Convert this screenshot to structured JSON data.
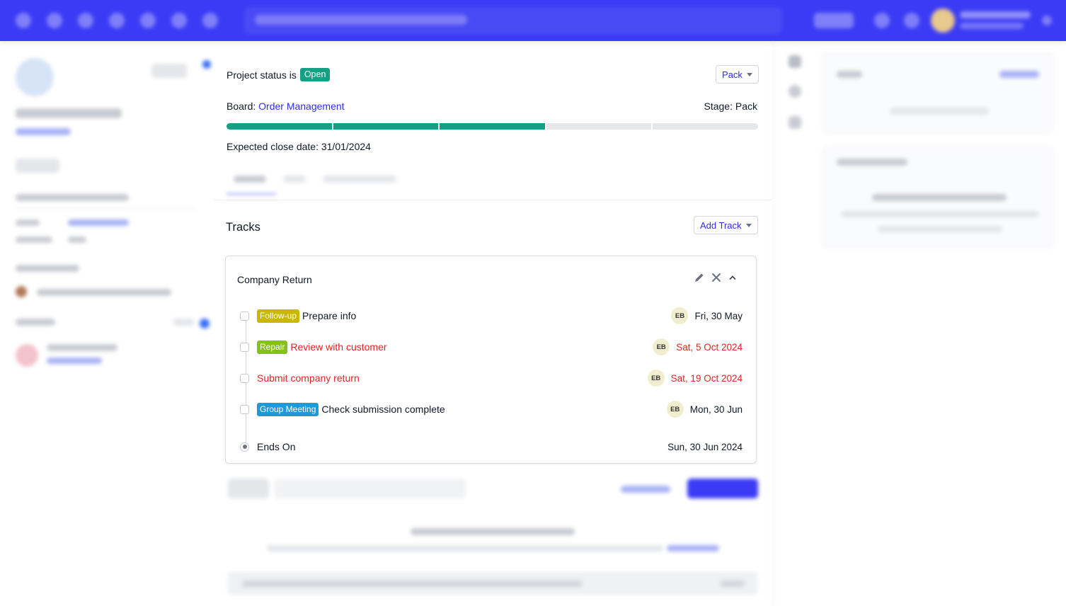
{
  "project": {
    "status_prefix": "Project status is",
    "status_badge": "Open",
    "stage_button": "Pack",
    "board_label": "Board:",
    "board_name": "Order Management",
    "stage_label": "Stage: Pack",
    "close_date_label": "Expected close date: 31/01/2024",
    "progress": {
      "segments_total": 5,
      "segments_completed": 3
    }
  },
  "tracks": {
    "title": "Tracks",
    "add_button": "Add Track",
    "card": {
      "title": "Company Return",
      "items": [
        {
          "tag": "Follow-up",
          "tag_color": "#c8b800",
          "task": "Prepare info",
          "assignee": "EB",
          "date": "Fri, 30 May",
          "overdue": false
        },
        {
          "tag": "Repair",
          "tag_color": "#84c21a",
          "task": "Review with customer",
          "assignee": "EB",
          "date": "Sat, 5 Oct 2024",
          "overdue": true
        },
        {
          "tag": "",
          "tag_color": "",
          "task": "Submit company return",
          "assignee": "EB",
          "date": "Sat, 19 Oct 2024",
          "overdue": true
        },
        {
          "tag": "Group Meeting",
          "tag_color": "#1f9ad6",
          "task": "Check submission complete",
          "assignee": "EB",
          "date": "Mon, 30 Jun",
          "overdue": false
        }
      ],
      "ends_label": "Ends On",
      "ends_date": "Sun, 30 Jun 2024"
    }
  },
  "colors": {
    "accent": "#3b3bf5",
    "link": "#2f2fe0",
    "success": "#14a085",
    "overdue": "#e02424"
  },
  "icons": [
    "pencil-icon",
    "close-icon",
    "chevron-up-icon",
    "caret-down-icon"
  ]
}
